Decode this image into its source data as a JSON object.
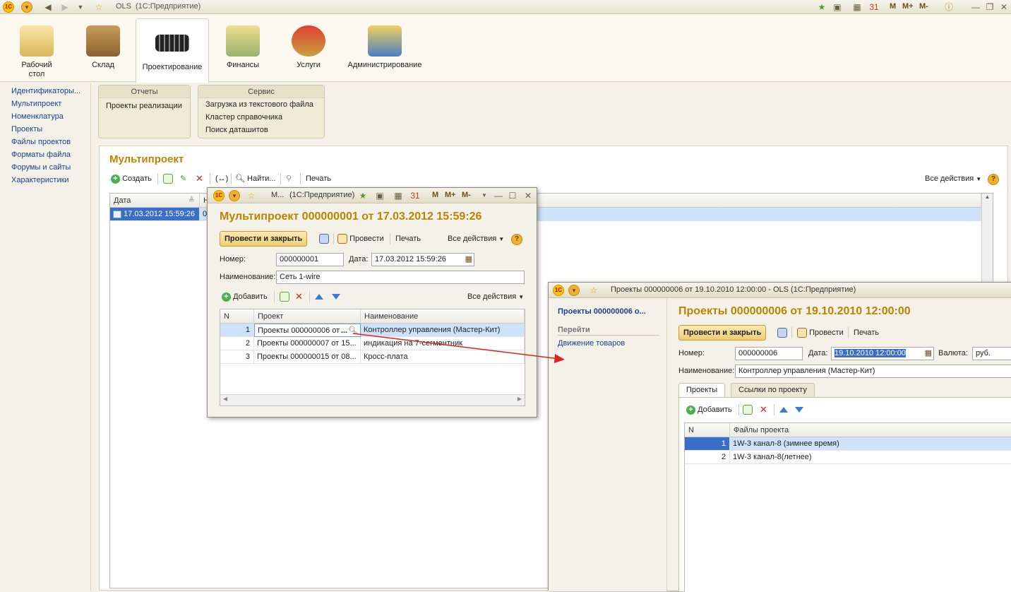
{
  "app": {
    "title": "OLS",
    "subtitle": "(1С:Предприятие)",
    "titlebar_right": [
      "M",
      "M+",
      "M-"
    ]
  },
  "sections": [
    {
      "label": "Рабочий стол",
      "icon": "desktop-icon"
    },
    {
      "label": "Склад",
      "icon": "warehouse-icon"
    },
    {
      "label": "Проектирование",
      "icon": "chip-icon"
    },
    {
      "label": "Финансы",
      "icon": "money-icon"
    },
    {
      "label": "Услуги",
      "icon": "valve-icon"
    },
    {
      "label": "Администрирование",
      "icon": "admin-icon"
    }
  ],
  "nav": {
    "items": [
      "Идентификаторы...",
      "Мультипроект",
      "Номенклатура",
      "Проекты",
      "Файлы проектов",
      "Форматы файла",
      "Форумы и сайты",
      "Характеристики"
    ]
  },
  "groups": {
    "reports": {
      "title": "Отчеты",
      "items": [
        "Проекты реализации"
      ]
    },
    "service": {
      "title": "Сервис",
      "items": [
        "Загрузка из текстового файла",
        "Кластер справочника",
        "Поиск даташитов"
      ]
    }
  },
  "list_form": {
    "title": "Мультипроект",
    "toolbar": {
      "create": "Создать",
      "find": "Найти...",
      "print": "Печать",
      "all_actions": "Все действия"
    },
    "columns": [
      "Дата",
      "Н"
    ],
    "rows": [
      {
        "date": "17.03.2012 15:59:26",
        "num": "0"
      }
    ]
  },
  "multiproject_window": {
    "tb_title": "М...",
    "tb_subtitle": "(1С:Предприятие)",
    "tb_buttons": [
      "M",
      "M+",
      "M-"
    ],
    "heading": "Мультипроект 000000001 от 17.03.2012 15:59:26",
    "btn_post_close": "Провести и закрыть",
    "btn_post": "Провести",
    "btn_print": "Печать",
    "all_actions": "Все действия",
    "number_label": "Номер:",
    "number_value": "000000001",
    "date_label": "Дата:",
    "date_value": "17.03.2012 15:59:26",
    "name_label": "Наименование:",
    "name_value": "Сеть 1-wire",
    "add_label": "Добавить",
    "all_actions2": "Все действия",
    "columns": [
      "N",
      "Проект",
      "Наименование"
    ],
    "rows": [
      {
        "n": "1",
        "project": "Проекты 000000006 от",
        "name": "Контроллер управления (Мастер-Кит)"
      },
      {
        "n": "2",
        "project": "Проекты 000000007 от 15...",
        "name": "индикация на 7-сегментник"
      },
      {
        "n": "3",
        "project": "Проекты 000000015 от 08...",
        "name": "Кросс-плата"
      }
    ]
  },
  "project_window": {
    "tb_title": "Проекты 000000006 от 19.10.2010 12:00:00 - OLS  (1С:Предприятие)",
    "side_title": "Проекты 000000006 о...",
    "side_goto": "Перейти",
    "side_link": "Движение товаров",
    "heading": "Проекты 000000006 от 19.10.2010 12:00:00",
    "btn_post_close": "Провести и закрыть",
    "btn_post": "Провести",
    "btn_print": "Печать",
    "number_label": "Номер:",
    "number_value": "000000006",
    "date_label": "Дата:",
    "date_value": "19.10.2010 12:00:00",
    "currency_label": "Валюта:",
    "currency_value": "руб.",
    "name_label": "Наименование:",
    "name_value": "Контроллер управления (Мастер-Кит)",
    "tabs": [
      "Проекты",
      "Ссылки по проекту"
    ],
    "add_label": "Добавить",
    "columns": [
      "N",
      "Файлы проекта"
    ],
    "rows": [
      {
        "n": "1",
        "file": "1W-3 канал-8 (зимнее время)"
      },
      {
        "n": "2",
        "file": "1W-3 канал-8(летнее)"
      }
    ]
  },
  "colors": {
    "accent": "#b98400",
    "selection": "#cfe2f9",
    "arrow": "#e02020"
  }
}
